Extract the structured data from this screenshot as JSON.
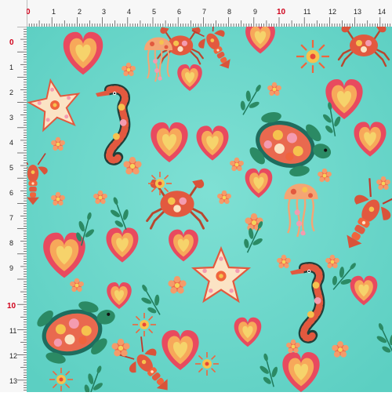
{
  "ruler": {
    "top_labels": [
      "0",
      "1",
      "2",
      "3",
      "4",
      "5",
      "6",
      "7",
      "8",
      "9",
      "10",
      "11",
      "12",
      "13",
      "14"
    ],
    "left_labels": [
      "0",
      "1",
      "2",
      "3",
      "4",
      "5",
      "6",
      "7",
      "8",
      "9",
      "10",
      "11",
      "12",
      "13"
    ],
    "highlight_label": "10",
    "highlight_color": "#d0021b"
  },
  "fabric": {
    "background_color": "#6fd9cc",
    "motifs": [
      "heart",
      "starfish",
      "seahorse",
      "sea-turtle",
      "crab",
      "jellyfish",
      "lobster",
      "flower",
      "leaf-sprig",
      "sunburst"
    ]
  }
}
